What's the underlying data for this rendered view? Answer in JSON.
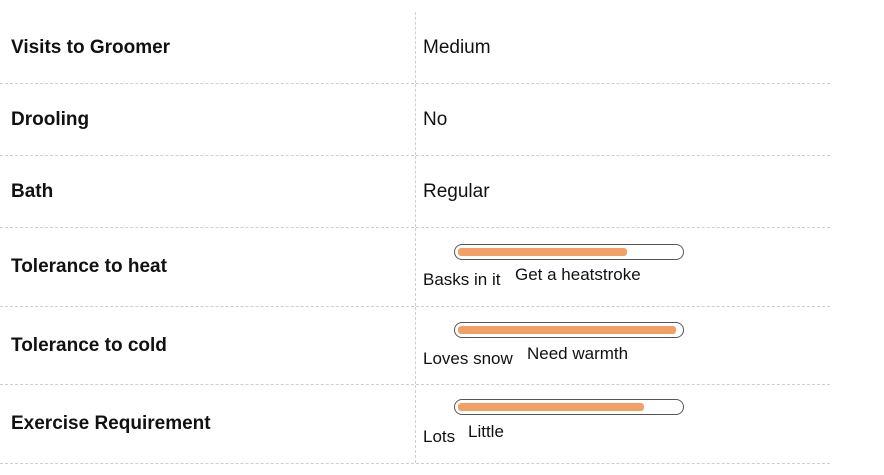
{
  "rows": [
    {
      "label": "Visits to Groomer",
      "value": "Medium"
    },
    {
      "label": "Drooling",
      "value": "No"
    },
    {
      "label": "Bath",
      "value": "Regular"
    },
    {
      "label": "Tolerance to heat",
      "meter": {
        "low": "Basks in it",
        "high": "Get a heatstroke",
        "level": 0.76
      }
    },
    {
      "label": "Tolerance to cold",
      "meter": {
        "low": "Loves snow",
        "high": "Need warmth",
        "level": 0.98
      }
    },
    {
      "label": "Exercise Requirement",
      "meter": {
        "low": "Lots",
        "high": "Little",
        "level": 0.84
      }
    }
  ],
  "colors": {
    "bar_fill": "#f3a066",
    "divider": "#cfcfcf"
  }
}
